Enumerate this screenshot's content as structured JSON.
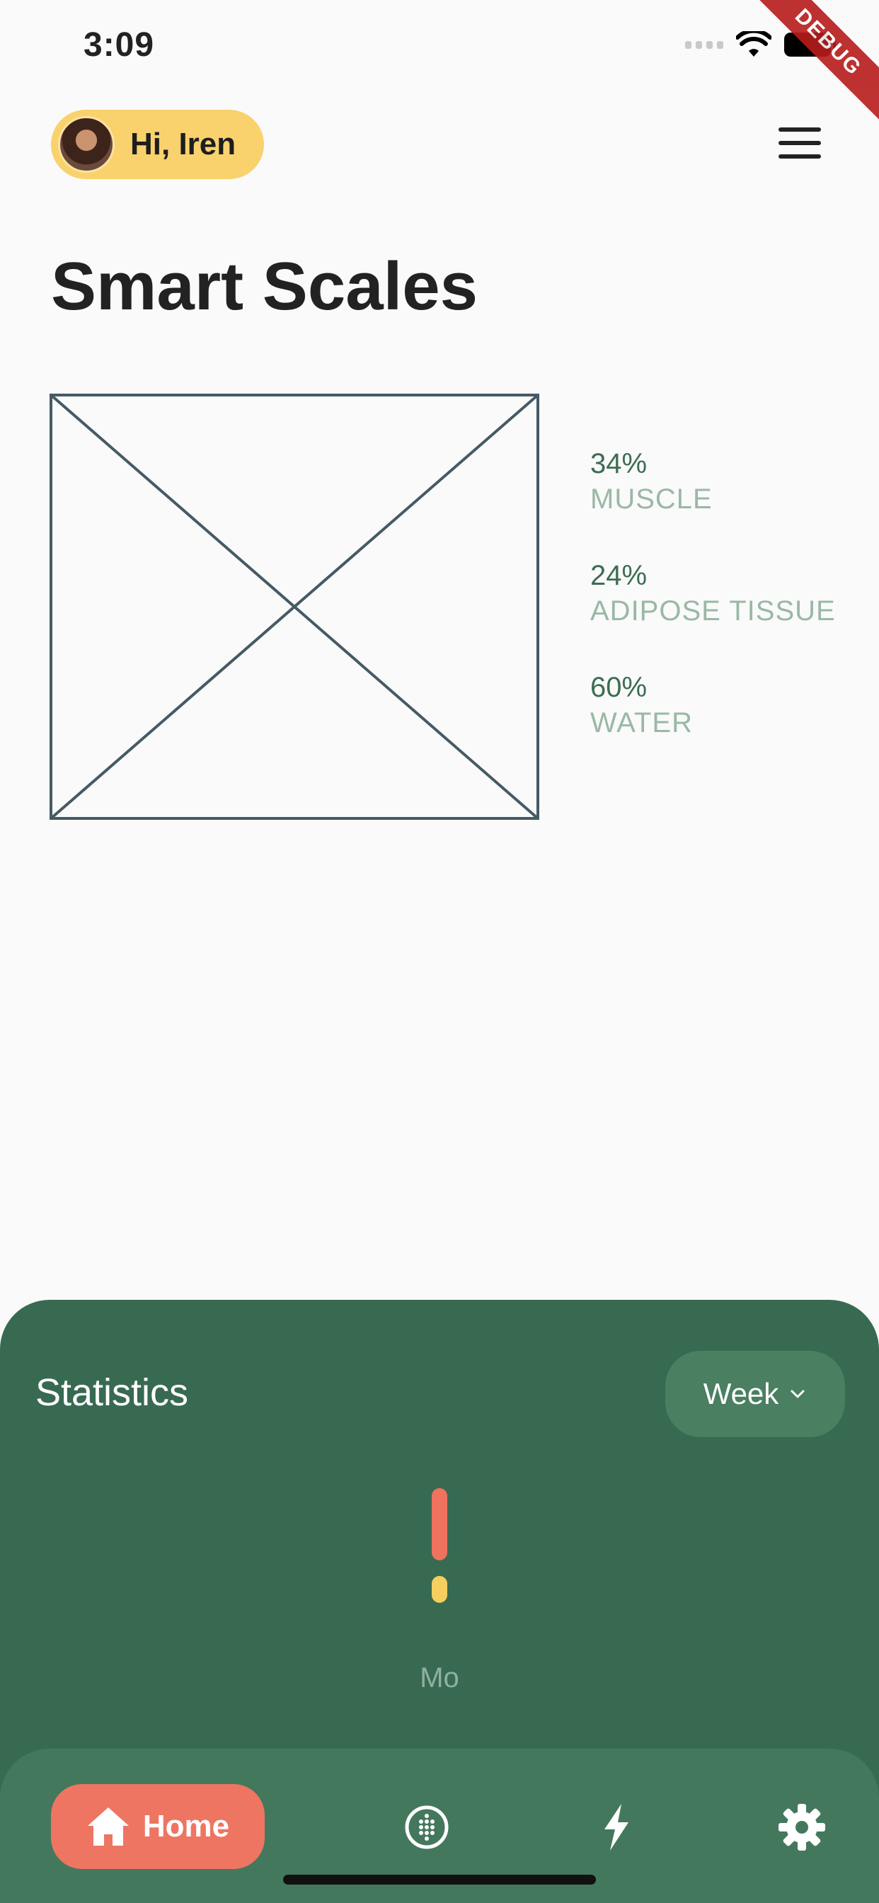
{
  "status_bar": {
    "time": "3:09"
  },
  "debug_banner": "DEBUG",
  "header": {
    "greeting": "Hi, Iren"
  },
  "page": {
    "title": "Smart Scales"
  },
  "composition": [
    {
      "value": "34%",
      "label": "MUSCLE"
    },
    {
      "value": "24%",
      "label": "ADIPOSE TISSUE"
    },
    {
      "value": "60%",
      "label": "WATER"
    }
  ],
  "statistics": {
    "title": "Statistics",
    "period": "Week",
    "day_label": "Mo"
  },
  "bottom_nav": {
    "home_label": "Home",
    "icons": [
      "home-icon",
      "globe-icon",
      "bolt-icon",
      "gear-icon"
    ]
  },
  "colors": {
    "accent_yellow": "#f9d26d",
    "panel_green": "#386a51",
    "nav_green": "#44785d",
    "home_coral": "#ee7562",
    "bar_red": "#ee725e",
    "bar_yellow": "#f6cf5e"
  }
}
